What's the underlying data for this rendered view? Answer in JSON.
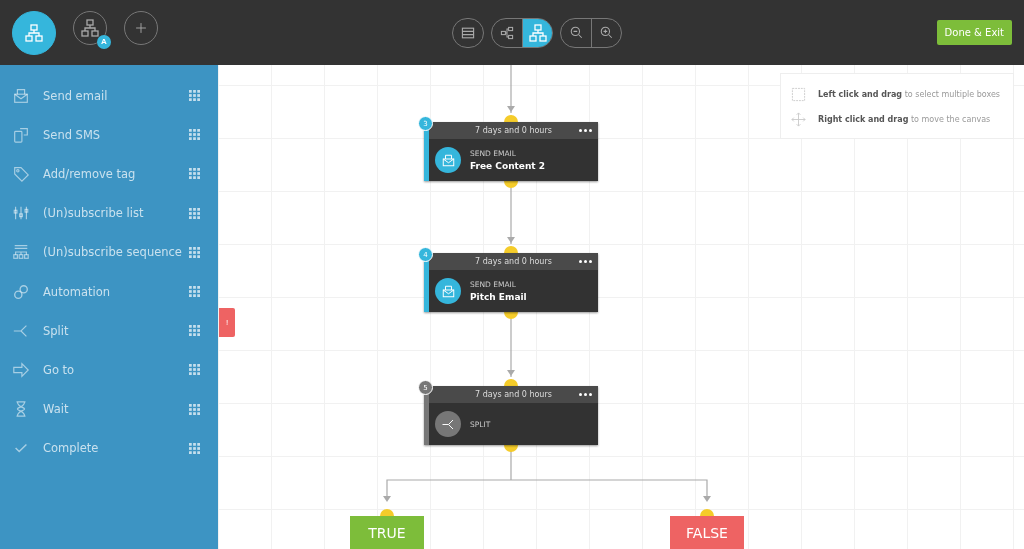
{
  "header": {
    "mode_buttons": [
      {
        "selected": true
      },
      {
        "selected": false,
        "badge": "A"
      },
      {
        "selected": false
      }
    ],
    "view_toggle": [
      {
        "selected": false
      }
    ],
    "layout_toggle": [
      {
        "selected": false
      },
      {
        "selected": true
      }
    ],
    "zoom_buttons": [
      {
        "selected": false
      },
      {
        "selected": false
      }
    ],
    "done_button": "Done & Exit"
  },
  "sidebar": {
    "items": [
      {
        "label": "Send email"
      },
      {
        "label": "Send SMS"
      },
      {
        "label": "Add/remove tag"
      },
      {
        "label": "(Un)subscribe list"
      },
      {
        "label": "(Un)subscribe sequence"
      },
      {
        "label": "Automation"
      },
      {
        "label": "Split"
      },
      {
        "label": "Go to"
      },
      {
        "label": "Wait"
      },
      {
        "label": "Complete"
      }
    ],
    "collapse_tab": "!"
  },
  "help": [
    "**Left click and drag** to select multiple boxes",
    "**Right click and drag** to move the canvas"
  ],
  "nodes": [
    {
      "step": "3",
      "delay": "7 days and 0 hours",
      "kind": "email",
      "type": "SEND EMAIL",
      "name": "Free Content 2"
    },
    {
      "step": "4",
      "delay": "7 days and 0 hours",
      "kind": "email",
      "type": "SEND EMAIL",
      "name": "Pitch Email"
    },
    {
      "step": "5",
      "delay": "7 days and 0 hours",
      "kind": "split",
      "type": "SPLIT"
    }
  ],
  "branches": [
    {
      "kind": "true",
      "label": "TRUE"
    },
    {
      "kind": "false",
      "label": "FALSE"
    }
  ]
}
